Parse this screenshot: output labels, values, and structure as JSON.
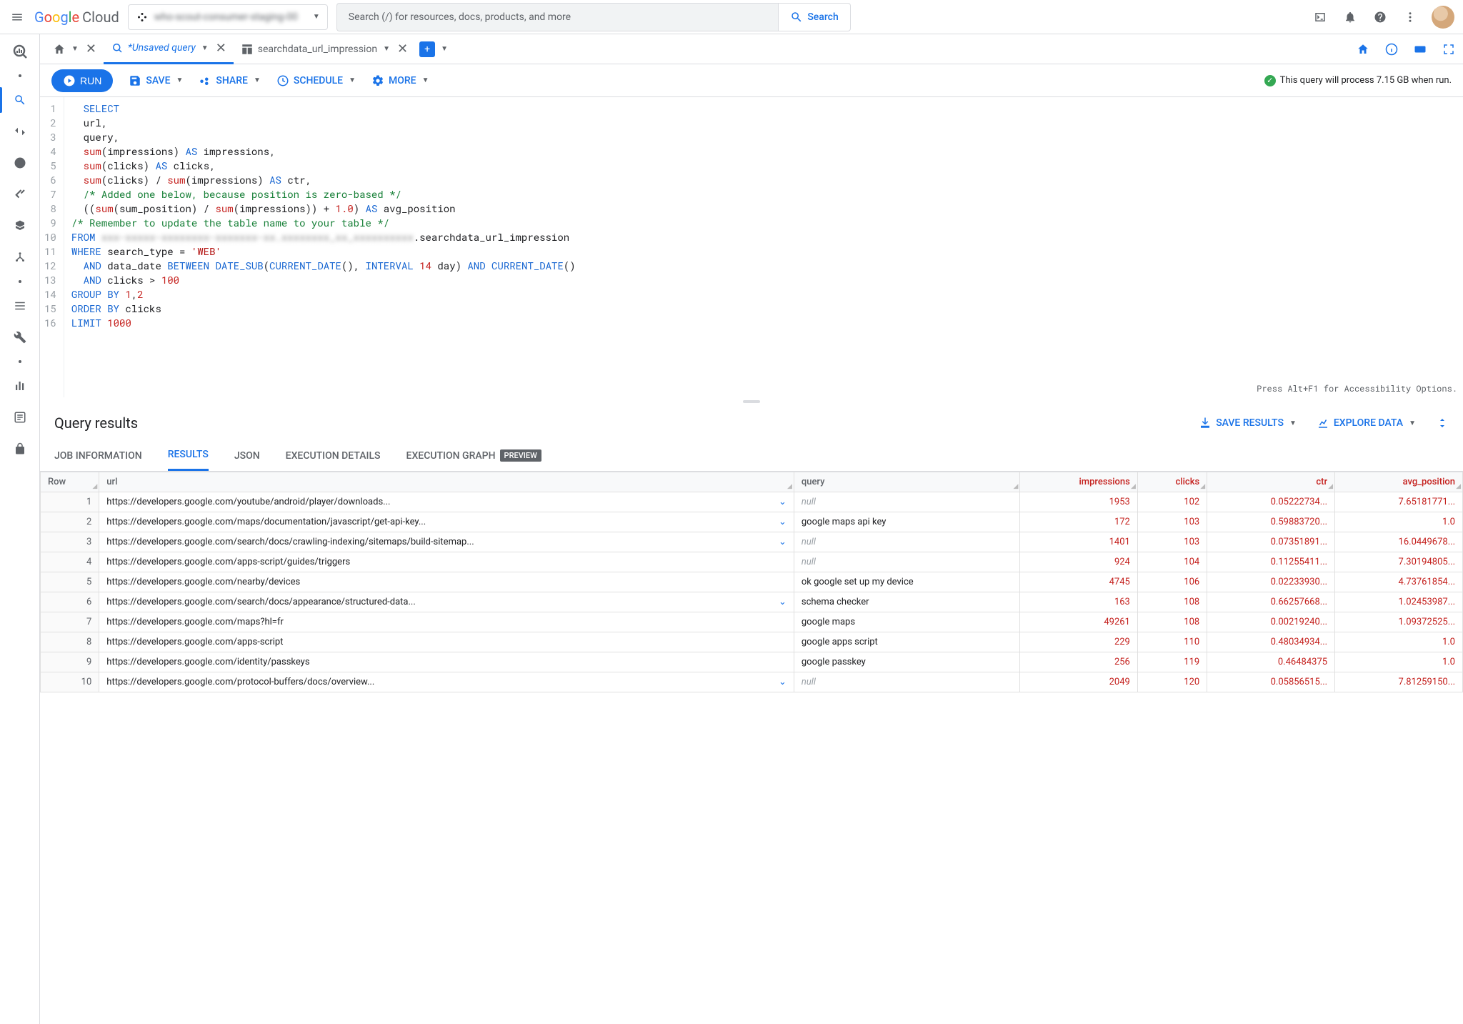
{
  "header": {
    "logo_cloud": "Cloud",
    "project_name": "who-scout-consumer-staging-00",
    "search_placeholder": "Search (/) for resources, docs, products, and more",
    "search_button": "Search"
  },
  "tabs": {
    "unsaved": "*Unsaved query",
    "table": "searchdata_url_impression"
  },
  "toolbar": {
    "run": "RUN",
    "save": "SAVE",
    "share": "SHARE",
    "schedule": "SCHEDULE",
    "more": "MORE",
    "cost": "This query will process 7.15 GB when run."
  },
  "editor": {
    "accessibility": "Press Alt+F1 for Accessibility Options.",
    "lines": [
      [
        {
          "t": "  "
        },
        {
          "t": "SELECT",
          "c": "kw"
        }
      ],
      [
        {
          "t": "  url,"
        }
      ],
      [
        {
          "t": "  query,"
        }
      ],
      [
        {
          "t": "  "
        },
        {
          "t": "sum",
          "c": "fn"
        },
        {
          "t": "(impressions) "
        },
        {
          "t": "AS",
          "c": "kw"
        },
        {
          "t": " impressions,"
        }
      ],
      [
        {
          "t": "  "
        },
        {
          "t": "sum",
          "c": "fn"
        },
        {
          "t": "(clicks) "
        },
        {
          "t": "AS",
          "c": "kw"
        },
        {
          "t": " clicks,"
        }
      ],
      [
        {
          "t": "  "
        },
        {
          "t": "sum",
          "c": "fn"
        },
        {
          "t": "(clicks) / "
        },
        {
          "t": "sum",
          "c": "fn"
        },
        {
          "t": "(impressions) "
        },
        {
          "t": "AS",
          "c": "kw"
        },
        {
          "t": " ctr,"
        }
      ],
      [
        {
          "t": "  "
        },
        {
          "t": "/* Added one below, because position is zero-based */",
          "c": "cm"
        }
      ],
      [
        {
          "t": "  (("
        },
        {
          "t": "sum",
          "c": "fn"
        },
        {
          "t": "(sum_position) / "
        },
        {
          "t": "sum",
          "c": "fn"
        },
        {
          "t": "(impressions)) + "
        },
        {
          "t": "1.0",
          "c": "num"
        },
        {
          "t": ") "
        },
        {
          "t": "AS",
          "c": "kw"
        },
        {
          "t": " avg_position"
        }
      ],
      [
        {
          "t": "/* Remember to update the table name to your table */",
          "c": "cm"
        }
      ],
      [
        {
          "t": "FROM",
          "c": "kw"
        },
        {
          "t": " "
        },
        {
          "t": "xxx-xxxxx-xxxxxxxx-xxxxxxx-xx.xxxxxxxx_xx_xxxxxxxxxx",
          "c": "blur-inline"
        },
        {
          "t": ".searchdata_url_impression"
        }
      ],
      [
        {
          "t": "WHERE",
          "c": "kw"
        },
        {
          "t": " search_type = "
        },
        {
          "t": "'WEB'",
          "c": "str"
        }
      ],
      [
        {
          "t": "  "
        },
        {
          "t": "AND",
          "c": "kw"
        },
        {
          "t": " data_date "
        },
        {
          "t": "BETWEEN",
          "c": "kw"
        },
        {
          "t": " "
        },
        {
          "t": "DATE_SUB",
          "c": "kw"
        },
        {
          "t": "("
        },
        {
          "t": "CURRENT_DATE",
          "c": "kw"
        },
        {
          "t": "(), "
        },
        {
          "t": "INTERVAL",
          "c": "kw"
        },
        {
          "t": " "
        },
        {
          "t": "14",
          "c": "num"
        },
        {
          "t": " day) "
        },
        {
          "t": "AND",
          "c": "kw"
        },
        {
          "t": " "
        },
        {
          "t": "CURRENT_DATE",
          "c": "kw"
        },
        {
          "t": "()"
        }
      ],
      [
        {
          "t": "  "
        },
        {
          "t": "AND",
          "c": "kw"
        },
        {
          "t": " clicks > "
        },
        {
          "t": "100",
          "c": "num"
        }
      ],
      [
        {
          "t": "GROUP BY",
          "c": "kw"
        },
        {
          "t": " "
        },
        {
          "t": "1",
          "c": "num"
        },
        {
          "t": ","
        },
        {
          "t": "2",
          "c": "num"
        }
      ],
      [
        {
          "t": "ORDER BY",
          "c": "kw"
        },
        {
          "t": " clicks"
        }
      ],
      [
        {
          "t": "LIMIT",
          "c": "kw"
        },
        {
          "t": " "
        },
        {
          "t": "1000",
          "c": "num"
        }
      ]
    ]
  },
  "results": {
    "title": "Query results",
    "save_results": "SAVE RESULTS",
    "explore_data": "EXPLORE DATA",
    "tabs": {
      "job": "JOB INFORMATION",
      "results": "RESULTS",
      "json": "JSON",
      "execution_details": "EXECUTION DETAILS",
      "execution_graph": "EXECUTION GRAPH",
      "preview": "PREVIEW"
    },
    "columns": [
      "Row",
      "url",
      "query",
      "impressions",
      "clicks",
      "ctr",
      "avg_position"
    ],
    "rows": [
      {
        "row": 1,
        "url": "https://developers.google.com/youtube/android/player/downloads...",
        "expand": true,
        "query": null,
        "impressions": "1953",
        "clicks": "102",
        "ctr": "0.05222734...",
        "avg": "7.65181771..."
      },
      {
        "row": 2,
        "url": "https://developers.google.com/maps/documentation/javascript/get-api-key...",
        "expand": true,
        "query": "google maps api key",
        "impressions": "172",
        "clicks": "103",
        "ctr": "0.59883720...",
        "avg": "1.0"
      },
      {
        "row": 3,
        "url": "https://developers.google.com/search/docs/crawling-indexing/sitemaps/build-sitemap...",
        "expand": true,
        "query": null,
        "impressions": "1401",
        "clicks": "103",
        "ctr": "0.07351891...",
        "avg": "16.0449678..."
      },
      {
        "row": 4,
        "url": "https://developers.google.com/apps-script/guides/triggers",
        "expand": false,
        "query": null,
        "impressions": "924",
        "clicks": "104",
        "ctr": "0.11255411...",
        "avg": "7.30194805..."
      },
      {
        "row": 5,
        "url": "https://developers.google.com/nearby/devices",
        "expand": false,
        "query": "ok google set up my device",
        "impressions": "4745",
        "clicks": "106",
        "ctr": "0.02233930...",
        "avg": "4.73761854..."
      },
      {
        "row": 6,
        "url": "https://developers.google.com/search/docs/appearance/structured-data...",
        "expand": true,
        "query": "schema checker",
        "impressions": "163",
        "clicks": "108",
        "ctr": "0.66257668...",
        "avg": "1.02453987..."
      },
      {
        "row": 7,
        "url": "https://developers.google.com/maps?hl=fr",
        "expand": false,
        "query": "google maps",
        "impressions": "49261",
        "clicks": "108",
        "ctr": "0.00219240...",
        "avg": "1.09372525..."
      },
      {
        "row": 8,
        "url": "https://developers.google.com/apps-script",
        "expand": false,
        "query": "google apps script",
        "impressions": "229",
        "clicks": "110",
        "ctr": "0.48034934...",
        "avg": "1.0"
      },
      {
        "row": 9,
        "url": "https://developers.google.com/identity/passkeys",
        "expand": false,
        "query": "google passkey",
        "impressions": "256",
        "clicks": "119",
        "ctr": "0.46484375",
        "avg": "1.0"
      },
      {
        "row": 10,
        "url": "https://developers.google.com/protocol-buffers/docs/overview...",
        "expand": true,
        "query": null,
        "impressions": "2049",
        "clicks": "120",
        "ctr": "0.05856515...",
        "avg": "7.81259150..."
      }
    ]
  }
}
